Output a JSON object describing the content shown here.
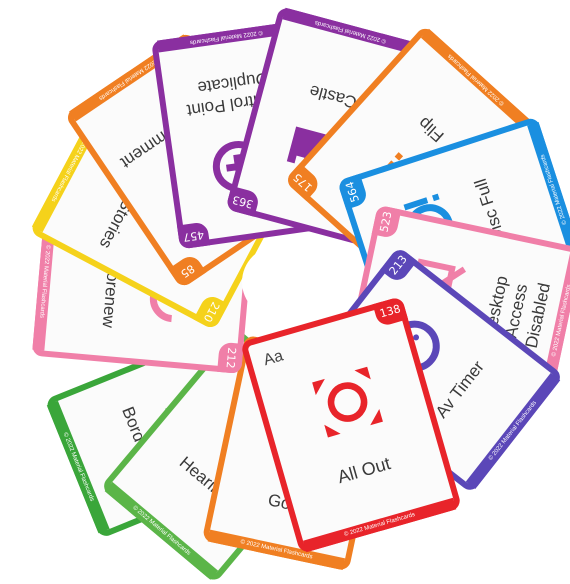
{
  "copyright": "© 2022 Material Flashcards",
  "cards": [
    {
      "name": "Border All",
      "num": "",
      "color": "#3aa63a",
      "icon": "border-all-icon"
    },
    {
      "name": "Hearing",
      "num": "",
      "color": "#5bb548",
      "icon": "hearing-icon"
    },
    {
      "name": "Goat",
      "num": "",
      "color": "#f07f22",
      "icon": "goat-icon"
    },
    {
      "name": "Autorenew",
      "num": "212",
      "color": "#f07fa8",
      "icon": "autorenew-icon"
    },
    {
      "name": "Add to Stories",
      "num": "210",
      "color": "#f5d21b",
      "icon": "add-to-stories-icon"
    },
    {
      "name": "Add Comment",
      "num": "85",
      "color": "#f07f22",
      "icon": "add-comment-icon"
    },
    {
      "name": "Control Point Duplicate",
      "num": "457",
      "color": "#8a2fa0",
      "icon": "control-point-duplicate-icon"
    },
    {
      "name": "Castle",
      "num": "363",
      "color": "#8a2fa0",
      "icon": "castle-icon"
    },
    {
      "name": "Flip",
      "num": "175",
      "color": "#f07f22",
      "icon": "flip-icon"
    },
    {
      "name": "Disc Full",
      "num": "564",
      "color": "#1a8fe0",
      "icon": "disc-full-icon"
    },
    {
      "name": "Desktop Access Disabled",
      "num": "523",
      "color": "#f07fa8",
      "icon": "desktop-access-disabled-icon"
    },
    {
      "name": "Av Timer",
      "num": "213",
      "color": "#5b47b8",
      "icon": "av-timer-icon"
    },
    {
      "name": "All Out",
      "num": "138",
      "color": "#e8242a",
      "icon": "all-out-icon",
      "glyph": "Aa"
    }
  ]
}
